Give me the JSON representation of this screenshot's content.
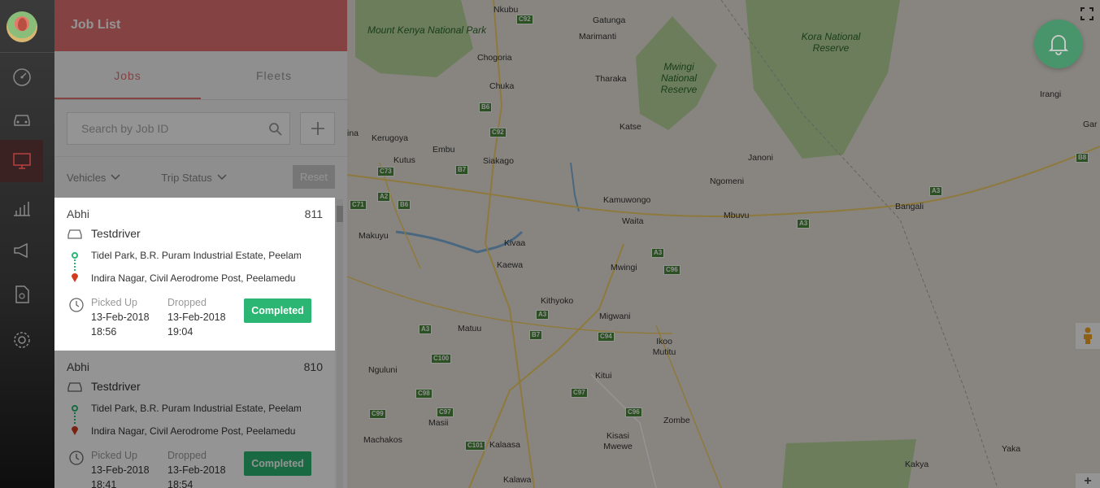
{
  "nav": {
    "items": [
      {
        "name": "dashboard"
      },
      {
        "name": "vehicles"
      },
      {
        "name": "live-tracking"
      },
      {
        "name": "reports"
      },
      {
        "name": "announcements"
      },
      {
        "name": "documents"
      },
      {
        "name": "settings"
      }
    ]
  },
  "panel": {
    "title": "Job List",
    "tabs": [
      {
        "label": "Jobs"
      },
      {
        "label": "Fleets"
      }
    ],
    "search_placeholder": "Search by Job ID",
    "filters": [
      {
        "label": "Vehicles"
      },
      {
        "label": "Trip Status"
      }
    ],
    "reset_label": "Reset"
  },
  "jobs": [
    {
      "customer": "Abhi",
      "job_id": "811",
      "driver": "Testdriver",
      "pickup": "Tidel Park, B.R. Puram Industrial Estate, Peelamedu",
      "drop": "Indira Nagar, Civil Aerodrome Post, Peelamedu",
      "picked_label": "Picked Up",
      "picked_date": "13-Feb-2018",
      "picked_time": "18:56",
      "dropped_label": "Dropped",
      "dropped_date": "13-Feb-2018",
      "dropped_time": "19:04",
      "status": "Completed"
    },
    {
      "customer": "Abhi",
      "job_id": "810",
      "driver": "Testdriver",
      "pickup": "Tidel Park, B.R. Puram Industrial Estate, Peelamedu",
      "drop": "Indira Nagar, Civil Aerodrome Post, Peelamedu",
      "picked_label": "Picked Up",
      "picked_date": "13-Feb-2018",
      "picked_time": "18:41",
      "dropped_label": "Dropped",
      "dropped_date": "13-Feb-2018",
      "dropped_time": "18:54",
      "status": "Completed"
    }
  ],
  "map": {
    "places": [
      "Nkubu",
      "Gatunga",
      "Marimanti",
      "Chogoria",
      "Chuka",
      "Tharaka",
      "Katse",
      "Kerugoya",
      "Kutus",
      "Embu",
      "Siakago",
      "Janoni",
      "Ngomeni",
      "Irangi",
      "Gar",
      "Makuyu",
      "Kamuwongo",
      "Waita",
      "Mbuvu",
      "Bangali",
      "Kivaa",
      "Kaewa",
      "Mwingi",
      "Kithyoko",
      "Migwani",
      "Matuu",
      "Ikoo Mutitu",
      "Nguluni",
      "Kitui",
      "Masii",
      "Zombe",
      "Machakos",
      "Kalaasa",
      "Kisasi Mwewe",
      "Yaka",
      "Kakya",
      "Kalawa",
      "ina"
    ],
    "parks": [
      "Mount Kenya National Park",
      "Kora National Reserve",
      "Mwingi National Reserve"
    ],
    "roads": [
      "C92",
      "B6",
      "C92",
      "C73",
      "B7",
      "A2",
      "B6",
      "C71",
      "A3",
      "A3",
      "B8",
      "A3",
      "C96",
      "A3",
      "B7",
      "C94",
      "A3",
      "C100",
      "C98",
      "C97",
      "C99",
      "C101",
      "C97",
      "C96"
    ]
  },
  "colors": {
    "header": "#e57373",
    "accent": "#e57373",
    "status": "#2bb673",
    "bell": "#1e9e5e"
  }
}
